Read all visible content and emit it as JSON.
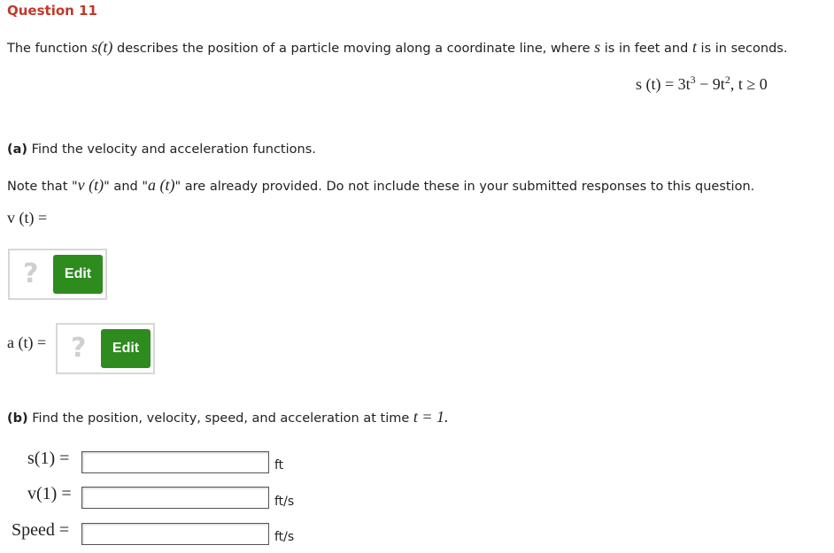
{
  "question_title": "Question 11",
  "intro": {
    "t1": "The function ",
    "s_of_t": "s(t)",
    "t2": " describes the position of a particle moving along a coordinate line, where ",
    "s": "s",
    "t3": " is in feet and ",
    "t": "t",
    "t4": " is in seconds."
  },
  "equation": {
    "lhs": "s (t) = 3t",
    "exp1": "3",
    "mid": " − 9t",
    "exp2": "2",
    "rhs": ", t ≥ 0"
  },
  "part_a": {
    "label": "(a)",
    "text": " Find the velocity and acceleration functions.",
    "note1": "Note that \"",
    "note_v": "v (t)",
    "note2": "\" and \"",
    "note_a": "a (t)",
    "note3": "\" are already provided. Do not include these in your submitted responses to this question.",
    "v_label": "v (t) =",
    "a_label": "a (t) =",
    "question_mark": "?",
    "edit_label": "Edit"
  },
  "part_b": {
    "label": "(b)",
    "text": " Find the position, velocity, speed, and acceleration at time ",
    "t_expr": "t = 1.",
    "rows": [
      {
        "label": "s(1) =",
        "unit": "ft",
        "value": ""
      },
      {
        "label": "v(1) =",
        "unit": "ft/s",
        "value": ""
      },
      {
        "label": "Speed =",
        "unit": "ft/s",
        "value": ""
      }
    ]
  }
}
